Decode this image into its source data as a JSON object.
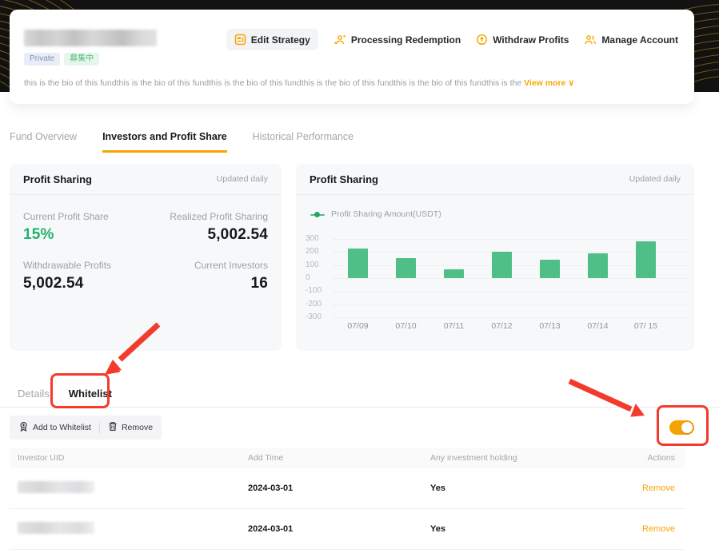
{
  "header": {
    "badges": [
      {
        "label": "Private"
      },
      {
        "label": "募集中"
      }
    ],
    "bio": "this is the bio of this fundthis is the bio of this fundthis is the bio of this fundthis is the bio of this fundthis is the bio of this fundthis is the",
    "view_more_label": "View more ∨",
    "actions": [
      {
        "label": "Edit Strategy",
        "icon": "edit-strategy-icon"
      },
      {
        "label": "Processing Redemption",
        "icon": "processing-redemption-icon"
      },
      {
        "label": "Withdraw Profits",
        "icon": "withdraw-profits-icon"
      },
      {
        "label": "Manage Account",
        "icon": "manage-account-icon"
      }
    ]
  },
  "tabs": [
    {
      "label": "Fund Overview",
      "active": false
    },
    {
      "label": "Investors and Profit Share",
      "active": true
    },
    {
      "label": "Historical Performance",
      "active": false
    }
  ],
  "profit_card": {
    "title": "Profit Sharing",
    "updated": "Updated daily",
    "stats": [
      {
        "label": "Current Profit Share",
        "value": "15%"
      },
      {
        "label": "Realized Profit Sharing",
        "value": "5,002.54"
      },
      {
        "label": "Withdrawable Profits",
        "value": "5,002.54"
      },
      {
        "label": "Current Investors",
        "value": "16"
      }
    ]
  },
  "chart_card": {
    "title": "Profit Sharing",
    "updated": "Updated daily"
  },
  "chart_data": {
    "type": "bar",
    "title": "Profit Sharing",
    "legend": [
      "Profit Sharing Amount(USDT)"
    ],
    "legend_position": "top-left",
    "categories": [
      "07/09",
      "07/10",
      "07/11",
      "07/12",
      "07/13",
      "07/14",
      "07/ 15"
    ],
    "values": [
      230,
      155,
      65,
      205,
      140,
      190,
      280
    ],
    "ylim": [
      -300,
      300
    ],
    "yticks": [
      300,
      200,
      100,
      0,
      -100,
      -200,
      -300
    ],
    "bar_color": "#4fbf87",
    "grid": true
  },
  "section_tabs": [
    {
      "label": "Details",
      "active": false
    },
    {
      "label": "Whitelist",
      "active": true
    }
  ],
  "toolbar": {
    "add_label": "Add to Whitelist",
    "remove_label": "Remove",
    "toggle_on": true
  },
  "table": {
    "columns": [
      "Investor UID",
      "Add Time",
      "Any investment holding",
      "Actions"
    ],
    "rows": [
      {
        "add_time": "2024-03-01",
        "holding": "Yes",
        "action": "Remove"
      },
      {
        "add_time": "2024-03-01",
        "holding": "Yes",
        "action": "Remove"
      }
    ]
  },
  "colors": {
    "accent": "#f7a600",
    "green_value": "#20b26c",
    "bar_green": "#4fbf87",
    "annotation_red": "#f23b2d"
  }
}
